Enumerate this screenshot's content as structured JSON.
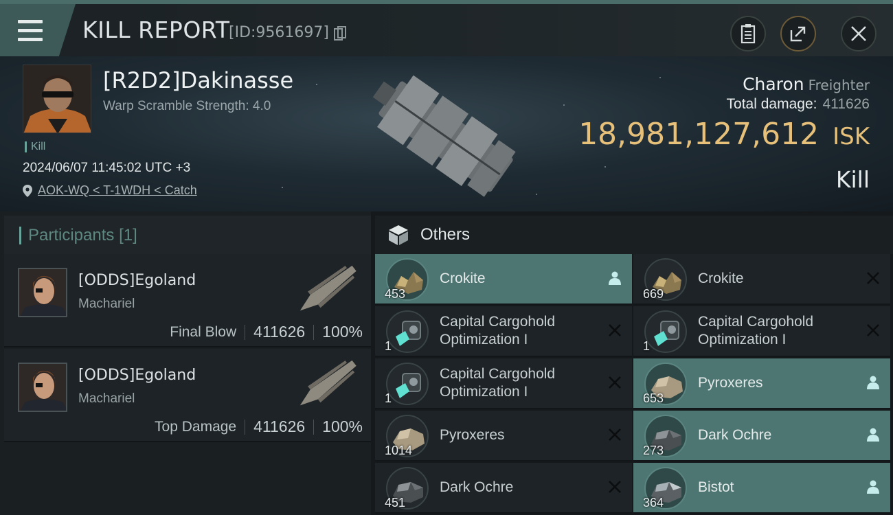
{
  "header": {
    "title": "KILL REPORT",
    "report_id": "[ID:9561697]"
  },
  "victim": {
    "name": "[R2D2]Dakinasse",
    "subtitle": "Warp Scramble Strength: 4.0",
    "tag": "Kill",
    "datetime": "2024/06/07 11:45:02 UTC +3",
    "location": "AOK-WQ < T-1WDH < Catch",
    "ship_name": "Charon",
    "ship_class": "Freighter",
    "total_damage_label": "Total damage:",
    "total_damage": "411626",
    "isk_value": "18,981,127,612",
    "isk_unit": "ISK",
    "result": "Kill"
  },
  "participants": {
    "label": "Participants",
    "count": "[1]",
    "rows": [
      {
        "name": "[ODDS]Egoland",
        "ship": "Machariel",
        "role": "Final Blow",
        "damage": "411626",
        "percent": "100%"
      },
      {
        "name": "[ODDS]Egoland",
        "ship": "Machariel",
        "role": "Top Damage",
        "damage": "411626",
        "percent": "100%"
      }
    ]
  },
  "others": {
    "label": "Others",
    "items": [
      {
        "name": "Crokite",
        "qty": "453",
        "status": "dropped",
        "icon": "ore-crokite-icon"
      },
      {
        "name": "Crokite",
        "qty": "669",
        "status": "destroyed",
        "icon": "ore-crokite-icon"
      },
      {
        "name": "Capital Cargohold Optimization I",
        "qty": "1",
        "status": "destroyed",
        "icon": "rig-icon"
      },
      {
        "name": "Capital Cargohold Optimization I",
        "qty": "1",
        "status": "destroyed",
        "icon": "rig-icon"
      },
      {
        "name": "Capital Cargohold Optimization I",
        "qty": "1",
        "status": "destroyed",
        "icon": "rig-icon"
      },
      {
        "name": "Pyroxeres",
        "qty": "653",
        "status": "dropped",
        "icon": "ore-pyroxeres-icon"
      },
      {
        "name": "Pyroxeres",
        "qty": "1014",
        "status": "destroyed",
        "icon": "ore-pyroxeres-icon"
      },
      {
        "name": "Dark Ochre",
        "qty": "273",
        "status": "dropped",
        "icon": "ore-dark-ochre-icon"
      },
      {
        "name": "Dark Ochre",
        "qty": "451",
        "status": "destroyed",
        "icon": "ore-dark-ochre-icon"
      },
      {
        "name": "Bistot",
        "qty": "364",
        "status": "dropped",
        "icon": "ore-bistot-icon"
      }
    ]
  },
  "colors": {
    "accent": "#4d7672",
    "isk": "#e7c07a",
    "header_bar": "#4a6d6a"
  }
}
